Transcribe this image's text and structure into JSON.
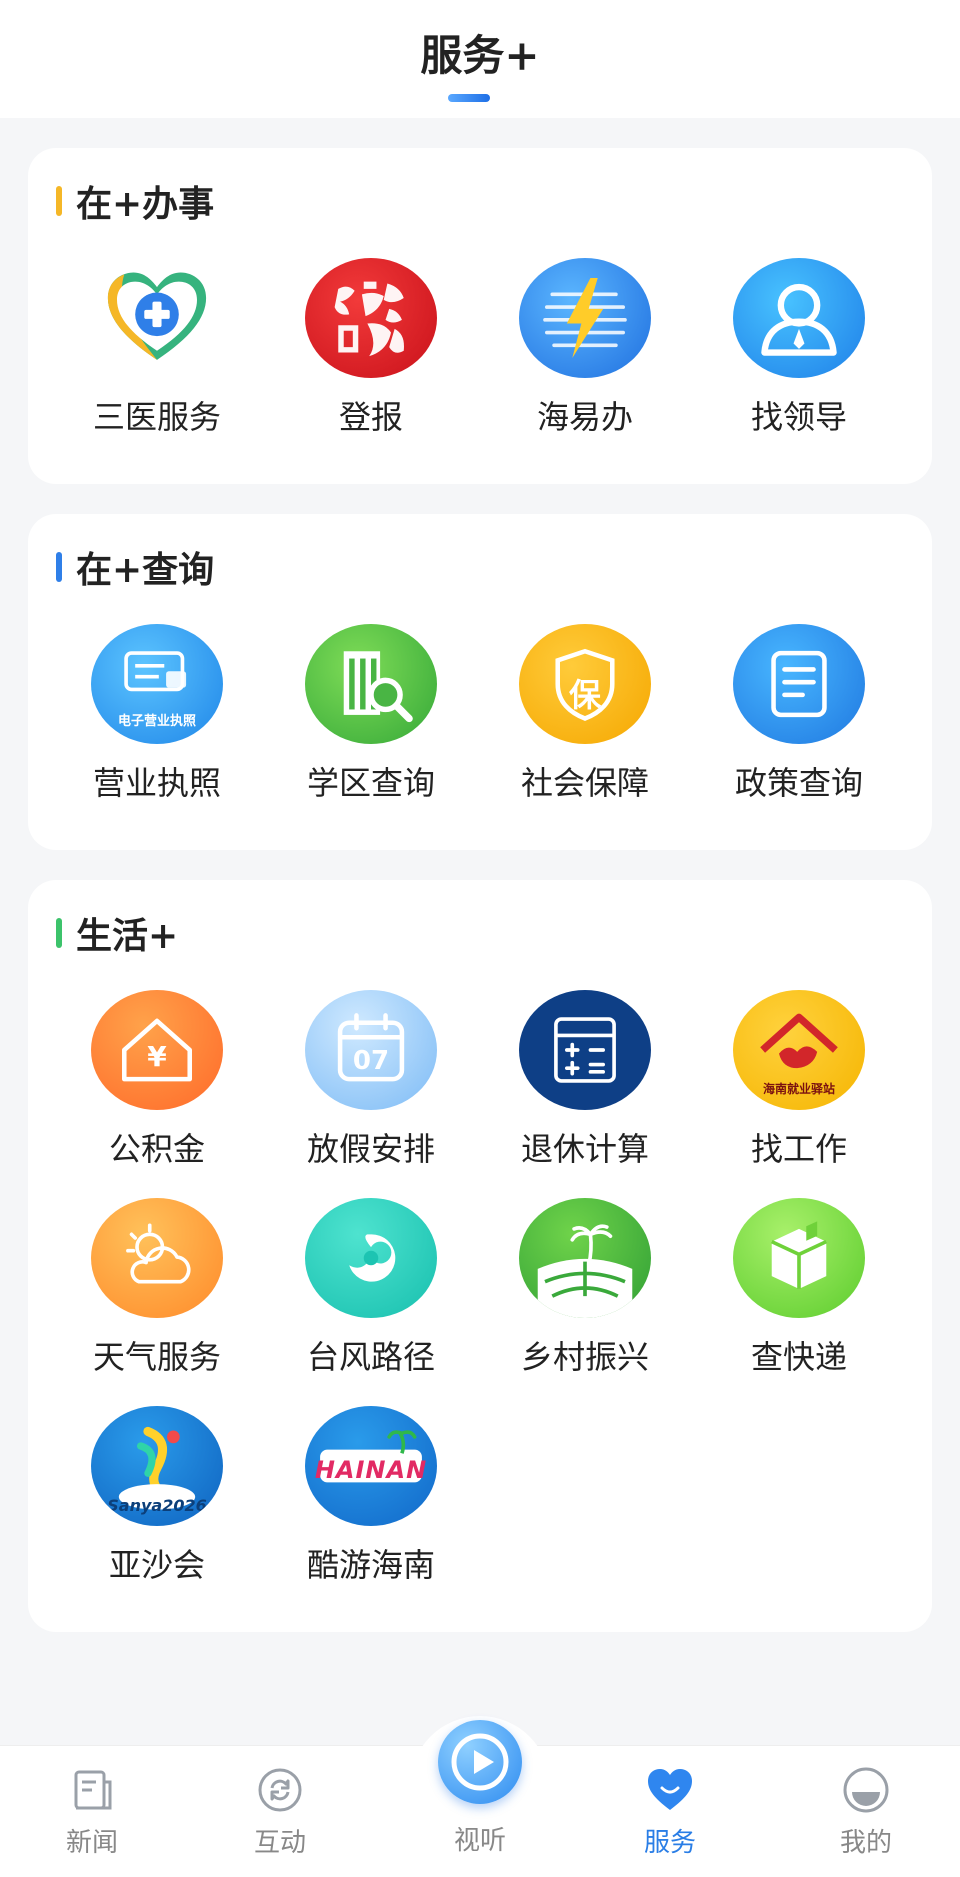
{
  "header": {
    "title": "服务+"
  },
  "sections": [
    {
      "title": "在+办事",
      "accent": "#f5b727",
      "items": [
        {
          "label": "三医服务",
          "icon": "heart-plus-icon"
        },
        {
          "label": "登报",
          "icon": "hainan-daily-logo"
        },
        {
          "label": "海易办",
          "icon": "lightning-globe-icon"
        },
        {
          "label": "找领导",
          "icon": "person-icon"
        }
      ]
    },
    {
      "title": "在+查询",
      "accent": "#2f7fe8",
      "items": [
        {
          "label": "营业执照",
          "icon": "business-license-icon",
          "badge": "电子营业执照"
        },
        {
          "label": "学区查询",
          "icon": "building-search-icon"
        },
        {
          "label": "社会保障",
          "icon": "shield-icon",
          "badge": "保"
        },
        {
          "label": "政策查询",
          "icon": "document-icon"
        }
      ]
    },
    {
      "title": "生活+",
      "accent": "#3cc36b",
      "items": [
        {
          "label": "公积金",
          "icon": "house-yuan-icon",
          "badge": "¥"
        },
        {
          "label": "放假安排",
          "icon": "calendar-icon",
          "badge": "07"
        },
        {
          "label": "退休计算",
          "icon": "calculator-icon"
        },
        {
          "label": "找工作",
          "icon": "hainan-jobs-logo",
          "badge": "海南就业驿站"
        },
        {
          "label": "天气服务",
          "icon": "weather-icon"
        },
        {
          "label": "台风路径",
          "icon": "typhoon-icon"
        },
        {
          "label": "乡村振兴",
          "icon": "rural-field-icon"
        },
        {
          "label": "查快递",
          "icon": "package-icon"
        },
        {
          "label": "亚沙会",
          "icon": "sanya2026-logo",
          "badge": "Sanya2026"
        },
        {
          "label": "酷游海南",
          "icon": "hainan-tourism-logo",
          "badge": "HAINAN"
        }
      ]
    }
  ],
  "nav": {
    "items": [
      {
        "label": "新闻",
        "icon": "news-icon"
      },
      {
        "label": "互动",
        "icon": "interact-icon"
      },
      {
        "label": "视听",
        "icon": "play-icon"
      },
      {
        "label": "服务",
        "icon": "heart-icon",
        "active": true
      },
      {
        "label": "我的",
        "icon": "profile-icon"
      }
    ]
  },
  "colors": {
    "accent_blue": "#2a7ee6",
    "nav_inactive": "#888888"
  }
}
